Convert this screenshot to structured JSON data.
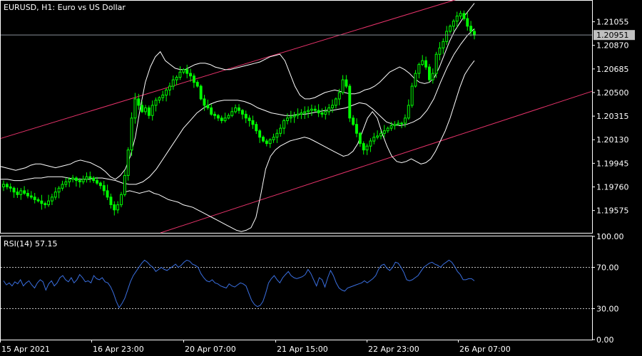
{
  "symbol_header": "EURUSD, H1:  Euro vs US Dollar",
  "rsi_header": "RSI(14) 57.15",
  "colors": {
    "background": "#000000",
    "frame": "#ffffff",
    "candle": "#00ff00",
    "bands": "#ffffff",
    "channel": "#e8336b",
    "rsi": "#3a6fe0",
    "price_line": "#8a8f99",
    "price_box_bg": "#c0c0c0",
    "level_line": "#c0c0c0"
  },
  "chart_data": [
    {
      "type": "candlestick",
      "title": "EURUSD, H1:  Euro vs US Dollar",
      "symbol": "EURUSD",
      "timeframe": "H1",
      "description": "Euro vs US Dollar",
      "ylim": [
        1.194,
        1.2122
      ],
      "y_ticks": [
        "1.21055",
        "1.20870",
        "1.20685",
        "1.20500",
        "1.20315",
        "1.20130",
        "1.19945",
        "1.19760",
        "1.19575"
      ],
      "y_tick_values": [
        1.21055,
        1.2087,
        1.20685,
        1.205,
        1.20315,
        1.2013,
        1.19945,
        1.1976,
        1.19575
      ],
      "x_ticks": [
        "15 Apr 2021",
        "16 Apr 23:00",
        "20 Apr 07:00",
        "21 Apr 15:00",
        "22 Apr 23:00",
        "26 Apr 07:00"
      ],
      "current_price": "1.20951",
      "close": [
        1.1978,
        1.1976,
        1.1975,
        1.1972,
        1.197,
        1.1973,
        1.1971,
        1.1969,
        1.1968,
        1.1966,
        1.1965,
        1.1963,
        1.1962,
        1.1965,
        1.1968,
        1.1972,
        1.1975,
        1.1978,
        1.198,
        1.1982,
        1.1983,
        1.1981,
        1.198,
        1.1982,
        1.1984,
        1.1983,
        1.1981,
        1.1979,
        1.1977,
        1.1973,
        1.1968,
        1.1962,
        1.1958,
        1.1962,
        1.197,
        1.1985,
        1.2005,
        1.203,
        1.2045,
        1.204,
        1.2035,
        1.2038,
        1.2032,
        1.204,
        1.2044,
        1.2046,
        1.2048,
        1.2052,
        1.2055,
        1.206,
        1.2062,
        1.2066,
        1.2068,
        1.2065,
        1.2063,
        1.2058,
        1.2055,
        1.2045,
        1.204,
        1.2038,
        1.2033,
        1.2032,
        1.203,
        1.2028,
        1.203,
        1.2032,
        1.2035,
        1.2038,
        1.2036,
        1.2033,
        1.203,
        1.2028,
        1.2025,
        1.202,
        1.2015,
        1.2012,
        1.201,
        1.2013,
        1.2015,
        1.2018,
        1.2022,
        1.2028,
        1.203,
        1.2031,
        1.2032,
        1.2033,
        1.2034,
        1.2035,
        1.2036,
        1.2037,
        1.2036,
        1.2034,
        1.2033,
        1.2035,
        1.2038,
        1.204,
        1.2045,
        1.205,
        1.206,
        1.2055,
        1.203,
        1.2025,
        1.2018,
        1.201,
        1.2005,
        1.2008,
        1.2012,
        1.2015,
        1.2016,
        1.2018,
        1.202,
        1.2022,
        1.2024,
        1.2025,
        1.2026,
        1.2026,
        1.203,
        1.204,
        1.2055,
        1.2065,
        1.2072,
        1.2075,
        1.207,
        1.206,
        1.2065,
        1.208,
        1.2085,
        1.209,
        1.2098,
        1.2102,
        1.2106,
        1.211,
        1.2112,
        1.2108,
        1.2102,
        1.2098,
        1.2095
      ],
      "bands_upper": [
        1.1992,
        1.1991,
        1.199,
        1.1989,
        1.199,
        1.1991,
        1.1993,
        1.1994,
        1.1994,
        1.1993,
        1.1992,
        1.1991,
        1.1992,
        1.1993,
        1.1994,
        1.1996,
        1.1997,
        1.1996,
        1.1995,
        1.1993,
        1.1991,
        1.1988,
        1.1984,
        1.1982,
        1.1985,
        1.199,
        1.2,
        1.2015,
        1.2038,
        1.2058,
        1.207,
        1.2078,
        1.2082,
        1.2075,
        1.2072,
        1.2069,
        1.2068,
        1.2068,
        1.207,
        1.2072,
        1.2073,
        1.2073,
        1.2072,
        1.207,
        1.2069,
        1.2068,
        1.2068,
        1.2069,
        1.207,
        1.2071,
        1.2072,
        1.2073,
        1.2074,
        1.2076,
        1.2078,
        1.2079,
        1.208,
        1.2075,
        1.2065,
        1.2055,
        1.2048,
        1.2045,
        1.2045,
        1.2046,
        1.2048,
        1.205,
        1.2051,
        1.2052,
        1.2051,
        1.205,
        1.2049,
        1.2049,
        1.205,
        1.2052,
        1.2053,
        1.2055,
        1.2058,
        1.2062,
        1.2066,
        1.2068,
        1.207,
        1.2068,
        1.2065,
        1.2061,
        1.2058,
        1.2057,
        1.2058,
        1.2062,
        1.207,
        1.208,
        1.209,
        1.2098,
        1.2104,
        1.211,
        1.2115,
        1.212
      ],
      "bands_middle": [
        1.1982,
        1.1982,
        1.1981,
        1.1981,
        1.1982,
        1.1983,
        1.1983,
        1.1984,
        1.1984,
        1.1984,
        1.1983,
        1.1982,
        1.1982,
        1.1982,
        1.1983,
        1.1983,
        1.1982,
        1.1981,
        1.1979,
        1.1978,
        1.1978,
        1.198,
        1.1984,
        1.199,
        1.1998,
        1.2006,
        1.2014,
        1.2022,
        1.2028,
        1.2034,
        1.2038,
        1.2041,
        1.2043,
        1.2044,
        1.2044,
        1.2044,
        1.2043,
        1.2041,
        1.2038,
        1.2036,
        1.2034,
        1.2033,
        1.2032,
        1.2032,
        1.2033,
        1.2033,
        1.2034,
        1.2035,
        1.2036,
        1.2036,
        1.2037,
        1.2038,
        1.204,
        1.2042,
        1.2041,
        1.2037,
        1.2032,
        1.2027,
        1.2025,
        1.2024,
        1.2025,
        1.2027,
        1.203,
        1.2036,
        1.2045,
        1.2058,
        1.207,
        1.208,
        1.2088,
        1.2095,
        1.21
      ],
      "bands_lower": [
        1.1972,
        1.1973,
        1.1972,
        1.1971,
        1.1972,
        1.1973,
        1.1971,
        1.197,
        1.1968,
        1.1966,
        1.1965,
        1.1964,
        1.1962,
        1.1961,
        1.196,
        1.1958,
        1.1956,
        1.1954,
        1.1952,
        1.195,
        1.1948,
        1.1946,
        1.1944,
        1.1942,
        1.1941,
        1.1942,
        1.1944,
        1.1952,
        1.197,
        1.199,
        1.2,
        1.2005,
        1.2008,
        1.201,
        1.2012,
        1.2013,
        1.2014,
        1.2015,
        1.2014,
        1.2012,
        1.201,
        1.2008,
        1.2006,
        1.2004,
        1.2002,
        1.2,
        1.2001,
        1.2004,
        1.201,
        1.202,
        1.203,
        1.2035,
        1.203,
        1.2018,
        1.2008,
        1.2,
        1.1996,
        1.1995,
        1.1996,
        1.1998,
        1.1996,
        1.1994,
        1.1995,
        1.1998,
        1.2004,
        1.2012,
        1.202,
        1.203,
        1.2042,
        1.2054,
        1.2064,
        1.207,
        1.2075
      ],
      "channel_upper": {
        "start": 1.2014,
        "end": 1.2123
      },
      "channel_lower": {
        "start": 1.194,
        "end": 1.2051
      }
    },
    {
      "type": "line",
      "title": "RSI(14) 57.15",
      "ylim": [
        0,
        100
      ],
      "y_ticks": [
        "100.00",
        "70.00",
        "30.00",
        "0.00"
      ],
      "y_tick_values": [
        100,
        70,
        30,
        0
      ],
      "levels": [
        70,
        30
      ],
      "series": [
        {
          "name": "RSI(14)",
          "values": [
            57,
            53,
            55,
            52,
            56,
            54,
            58,
            52,
            55,
            57,
            53,
            50,
            55,
            58,
            56,
            48,
            54,
            57,
            52,
            55,
            60,
            62,
            58,
            56,
            60,
            55,
            58,
            63,
            60,
            56,
            57,
            55,
            62,
            59,
            58,
            60,
            56,
            55,
            51,
            45,
            37,
            31,
            35,
            40,
            48,
            56,
            62,
            66,
            70,
            74,
            77,
            75,
            72,
            70,
            66,
            68,
            70,
            68,
            67,
            69,
            71,
            73,
            70,
            72,
            75,
            77,
            76,
            73,
            72,
            70,
            64,
            60,
            57,
            56,
            58,
            55,
            54,
            52,
            51,
            50,
            54,
            52,
            51,
            53,
            55,
            54,
            52,
            45,
            38,
            34,
            32,
            33,
            37,
            45,
            55,
            59,
            62,
            58,
            55,
            60,
            63,
            66,
            62,
            60,
            59,
            60,
            61,
            63,
            68,
            64,
            58,
            52,
            60,
            58,
            51,
            60,
            67,
            62,
            55,
            50,
            48,
            47,
            50,
            51,
            52,
            53,
            54,
            55,
            57,
            55,
            57,
            59,
            62,
            68,
            72,
            73,
            69,
            67,
            70,
            75,
            74,
            70,
            65,
            58,
            57,
            58,
            60,
            62,
            66,
            70,
            72,
            74,
            75,
            73,
            72,
            70,
            73,
            75,
            77,
            75,
            71,
            66,
            63,
            58,
            58,
            59,
            59,
            57
          ]
        }
      ]
    }
  ]
}
